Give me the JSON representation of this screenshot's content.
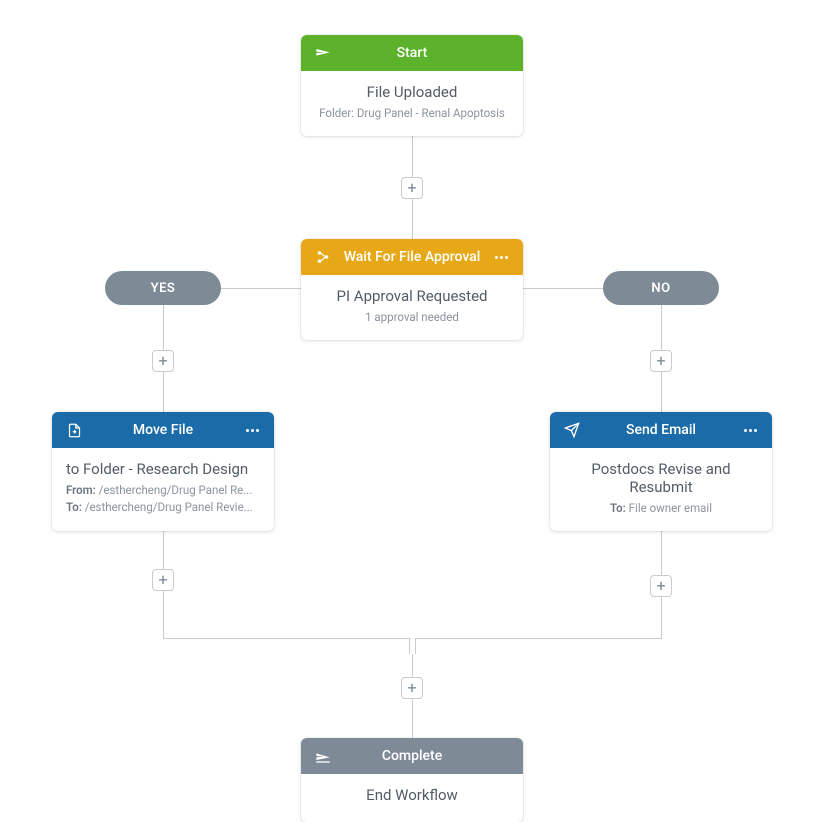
{
  "start": {
    "header": "Start",
    "title": "File Uploaded",
    "sub": "Folder: Drug Panel - Renal Apoptosis"
  },
  "approval": {
    "header": "Wait For File Approval",
    "title": "PI Approval Requested",
    "sub": "1 approval needed"
  },
  "yes": {
    "label": "YES"
  },
  "no": {
    "label": "NO"
  },
  "move": {
    "header": "Move File",
    "title": "to Folder - Research Design",
    "from_label": "From:",
    "from_value": "/esthercheng/Drug Panel Re...",
    "to_label": "To:",
    "to_value": "/esthercheng/Drug Panel Revie..."
  },
  "email": {
    "header": "Send Email",
    "title": "Postdocs Revise and Resubmit",
    "to_label": "To:",
    "to_value": "File owner email"
  },
  "complete": {
    "header": "Complete",
    "title": "End Workflow"
  },
  "plus_glyph": "+"
}
